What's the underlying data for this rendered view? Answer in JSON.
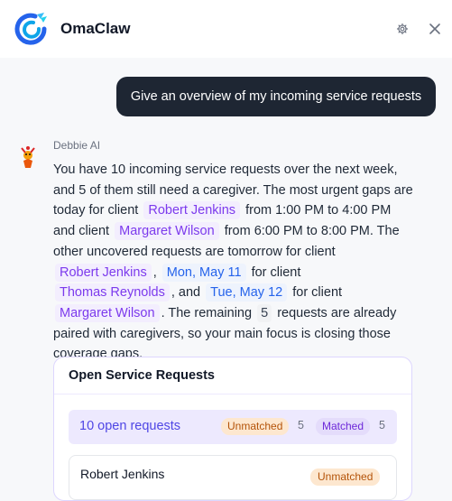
{
  "header": {
    "app_title": "OmaClaw",
    "settings_icon": "gear-icon",
    "close_icon": "close-icon"
  },
  "user_message": "Give an overview of my incoming service requests",
  "assistant": {
    "name": "Debbie AI",
    "avatar_icon": "bot-avatar-icon",
    "message": {
      "t1": "You have 10 incoming service requests over the next week, and 5 of them still need a caregiver. The most urgent gaps are today for client",
      "c1": "Robert Jenkins",
      "t2": "from 1:00 PM to 4:00 PM and client",
      "c2": "Margaret Wilson",
      "t3": "from 6:00 PM to 8:00 PM. The other uncovered requests are tomorrow for client",
      "c3": "Robert Jenkins",
      "t4": ",",
      "c4": "Mon, May 11",
      "t5": "for client",
      "c5": "Thomas Reynolds",
      "t6": ", and",
      "c6": "Tue, May 12",
      "t7": "for client",
      "c7": "Margaret Wilson",
      "t8": ". The remaining",
      "c8": "5",
      "t9": "requests are already paired with caregivers, so your main focus is closing those coverage gaps."
    }
  },
  "card": {
    "title": "Open Service Requests",
    "summary": {
      "label": "10 open requests",
      "unmatched_label": "Unmatched",
      "unmatched_count": "5",
      "matched_label": "Matched",
      "matched_count": "5"
    },
    "first_request": {
      "name": "Robert Jenkins",
      "status": "Unmatched"
    }
  },
  "colors": {
    "accent": "#7c3aed",
    "dark_bubble": "#1e2633",
    "unmatched": "#b45309",
    "link_blue": "#2563eb"
  }
}
